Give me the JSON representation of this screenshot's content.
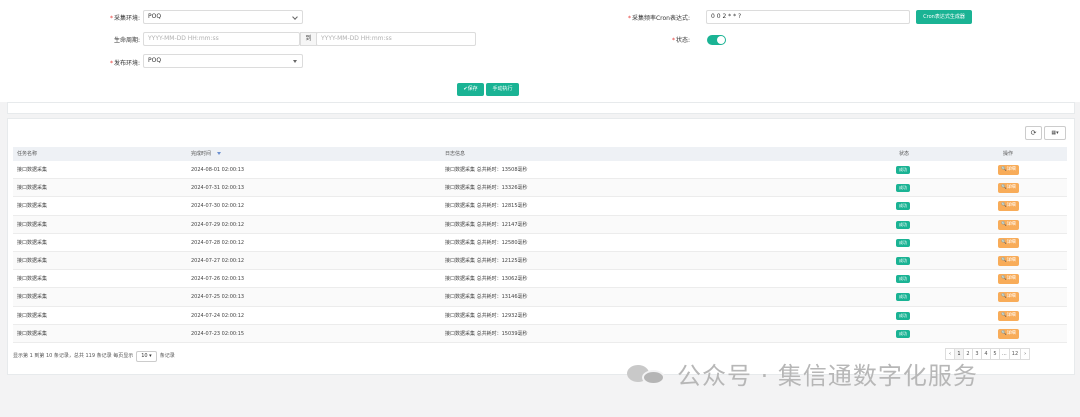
{
  "form": {
    "collect_env_label": "采集环境:",
    "collect_env_value": "POQ",
    "cron_label": "采集频率Cron表达式:",
    "cron_value": "0 0 2 * * ?",
    "cron_button": "Cron表达式生成器",
    "lifecycle_label": "生命周期:",
    "start_placeholder": "YYYY-MM-DD HH:mm:ss",
    "to_label": "到",
    "end_placeholder": "YYYY-MM-DD HH:mm:ss",
    "status_label": "状态:",
    "status_on": true,
    "publish_env_label": "发布环境:",
    "publish_env_value": "POQ",
    "required_mark": "*",
    "save_button": "✔保存",
    "manual_run_button": "手动执行"
  },
  "toolbar": {
    "refresh_icon": "refresh-icon",
    "columns_icon": "columns-grid-icon",
    "refresh_glyph": "⟳",
    "columns_glyph": "▦▾"
  },
  "table": {
    "headers": [
      "任务名称",
      "完成时间",
      "日志信息",
      "状态",
      "操作"
    ],
    "sort_icon": "sort-desc-icon",
    "rows": [
      {
        "name": "接口数据采集",
        "time": "2024-08-01 02:00:13",
        "log": "接口数据采集 总共耗时：13508毫秒",
        "status": "成功",
        "action": "🔍详细"
      },
      {
        "name": "接口数据采集",
        "time": "2024-07-31 02:00:13",
        "log": "接口数据采集 总共耗时：13326毫秒",
        "status": "成功",
        "action": "🔍详细"
      },
      {
        "name": "接口数据采集",
        "time": "2024-07-30 02:00:12",
        "log": "接口数据采集 总共耗时：12815毫秒",
        "status": "成功",
        "action": "🔍详细"
      },
      {
        "name": "接口数据采集",
        "time": "2024-07-29 02:00:12",
        "log": "接口数据采集 总共耗时：12147毫秒",
        "status": "成功",
        "action": "🔍详细"
      },
      {
        "name": "接口数据采集",
        "time": "2024-07-28 02:00:12",
        "log": "接口数据采集 总共耗时：12580毫秒",
        "status": "成功",
        "action": "🔍详细"
      },
      {
        "name": "接口数据采集",
        "time": "2024-07-27 02:00:12",
        "log": "接口数据采集 总共耗时：12125毫秒",
        "status": "成功",
        "action": "🔍详细"
      },
      {
        "name": "接口数据采集",
        "time": "2024-07-26 02:00:13",
        "log": "接口数据采集 总共耗时：13062毫秒",
        "status": "成功",
        "action": "🔍详细"
      },
      {
        "name": "接口数据采集",
        "time": "2024-07-25 02:00:13",
        "log": "接口数据采集 总共耗时：13146毫秒",
        "status": "成功",
        "action": "🔍详细"
      },
      {
        "name": "接口数据采集",
        "time": "2024-07-24 02:00:12",
        "log": "接口数据采集 总共耗时：12932毫秒",
        "status": "成功",
        "action": "🔍详细"
      },
      {
        "name": "接口数据采集",
        "time": "2024-07-23 02:00:15",
        "log": "接口数据采集 总共耗时：15039毫秒",
        "status": "成功",
        "action": "🔍详细"
      }
    ]
  },
  "footer": {
    "info_prefix": "显示第 1 到第 10 条记录，总共 119 条记录  每页显示",
    "page_size": "10 ▾",
    "info_suffix": "条记录"
  },
  "pagination": [
    "‹",
    "1",
    "2",
    "3",
    "4",
    "5",
    "...",
    "12",
    "›"
  ],
  "pagination_active": "1",
  "watermark": "公众号 · 集信通数字化服务",
  "colors": {
    "accent": "#1ab394",
    "warning": "#f8ac59",
    "required": "#e53935"
  }
}
